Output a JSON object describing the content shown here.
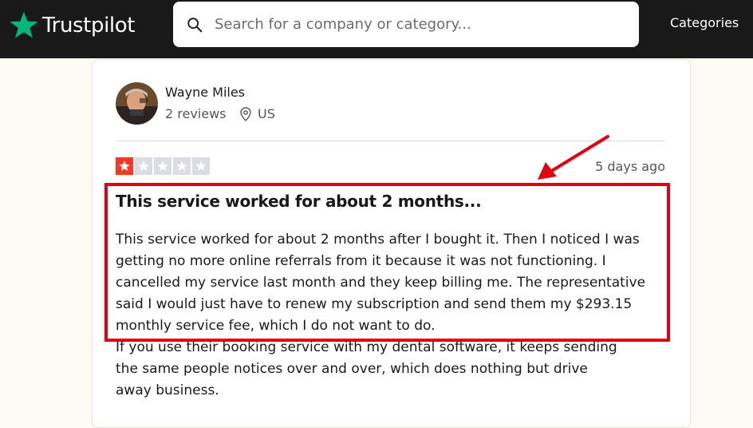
{
  "header": {
    "logo_text": "Trustpilot",
    "search_placeholder": "Search for a company or category...",
    "nav_categories": "Categories"
  },
  "review": {
    "reviewer_name": "Wayne Miles",
    "review_count": "2 reviews",
    "country": "US",
    "rating": 1,
    "rating_max": 5,
    "date": "5 days ago",
    "title": "This service worked for about 2 months...",
    "body": "This service worked for about 2 months after I bought it. Then I noticed I was\ngetting no more online referrals from it because it was not functioning. I\ncancelled my service last month and they keep billing me. The representative\nsaid I would just have to renew my subscription and send them my $293.15\nmonthly service fee, which I do not want to do.",
    "body_continued": "If you use their booking service with my dental software, it keeps sending\nthe same people notices over and over, which does nothing but drive\naway business."
  },
  "colors": {
    "header_bg": "#191919",
    "brand_green": "#00b67a",
    "star_red": "#ff3722",
    "star_empty": "#dcdce6",
    "annotation_red": "#e3000f"
  },
  "icons": [
    "trustpilot-star-icon",
    "search-icon",
    "location-pin-icon",
    "star-icon",
    "annotation-arrow-icon"
  ]
}
